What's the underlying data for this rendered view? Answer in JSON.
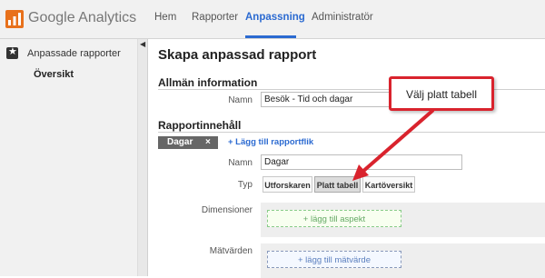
{
  "header": {
    "logo_text": "Google Analytics",
    "nav": [
      {
        "label": "Hem"
      },
      {
        "label": "Rapporter"
      },
      {
        "label": "Anpassning"
      },
      {
        "label": "Administratör"
      }
    ],
    "active_nav": "Anpassning",
    "accent_color": "#2b6ad1"
  },
  "sidebar": {
    "section_label": "Anpassade rapporter",
    "section_icon": "star-icon",
    "selected_item": "Översikt",
    "collapse_icon": "chevron-left-icon"
  },
  "main": {
    "page_title": "Skapa anpassad rapport",
    "general": {
      "title": "Allmän information",
      "name_label": "Namn",
      "name_value": "Besök - Tid och dagar"
    },
    "content": {
      "title": "Rapportinnehåll",
      "tab_label": "Dagar",
      "tab_close": "×",
      "add_tab": "+ Lägg till rapportflik",
      "name_label": "Namn",
      "name_value": "Dagar",
      "type_label": "Typ",
      "types": [
        "Utforskaren",
        "Platt tabell",
        "Kartöversikt"
      ],
      "selected_type": "Platt tabell",
      "dimensions_label": "Dimensioner",
      "add_dimension": "+ lägg till aspekt",
      "metrics_label": "Mätvärden",
      "add_metric": "+ lägg till mätvärde"
    }
  },
  "callout": {
    "text": "Välj platt tabell",
    "color": "#d9232d"
  }
}
